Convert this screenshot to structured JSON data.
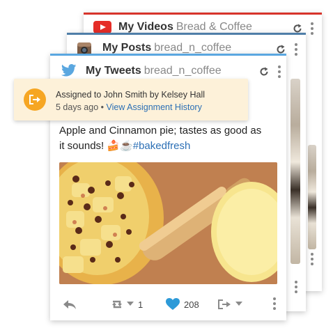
{
  "cards": {
    "youtube": {
      "name": "My Videos",
      "account": "Bread & Coffee",
      "accent": "#d7342b",
      "icon": "youtube-icon"
    },
    "instagram": {
      "name": "My Posts",
      "account": "bread_n_coffee",
      "accent": "#4f7ea8",
      "icon": "instagram-icon"
    },
    "twitter": {
      "name": "My Tweets",
      "account": "bread_n_coffee",
      "accent": "#5aa7e0",
      "icon": "twitter-bird-icon"
    }
  },
  "assignment": {
    "message": "Assigned to John Smith by Kelsey Hall",
    "age": "5 days ago",
    "separator": " • ",
    "link": "View Assignment History",
    "accent": "#f6a623"
  },
  "tweet": {
    "text": "Apple and Cinnamon pie; tastes as good as it sounds! ",
    "emoji": "🍰☕",
    "hashtag": "#bakedfresh",
    "photo_icon": "apple-pie-photo",
    "actions": {
      "retweet_count": "1",
      "like_count": "208",
      "like_color": "#2d9ad8"
    }
  }
}
